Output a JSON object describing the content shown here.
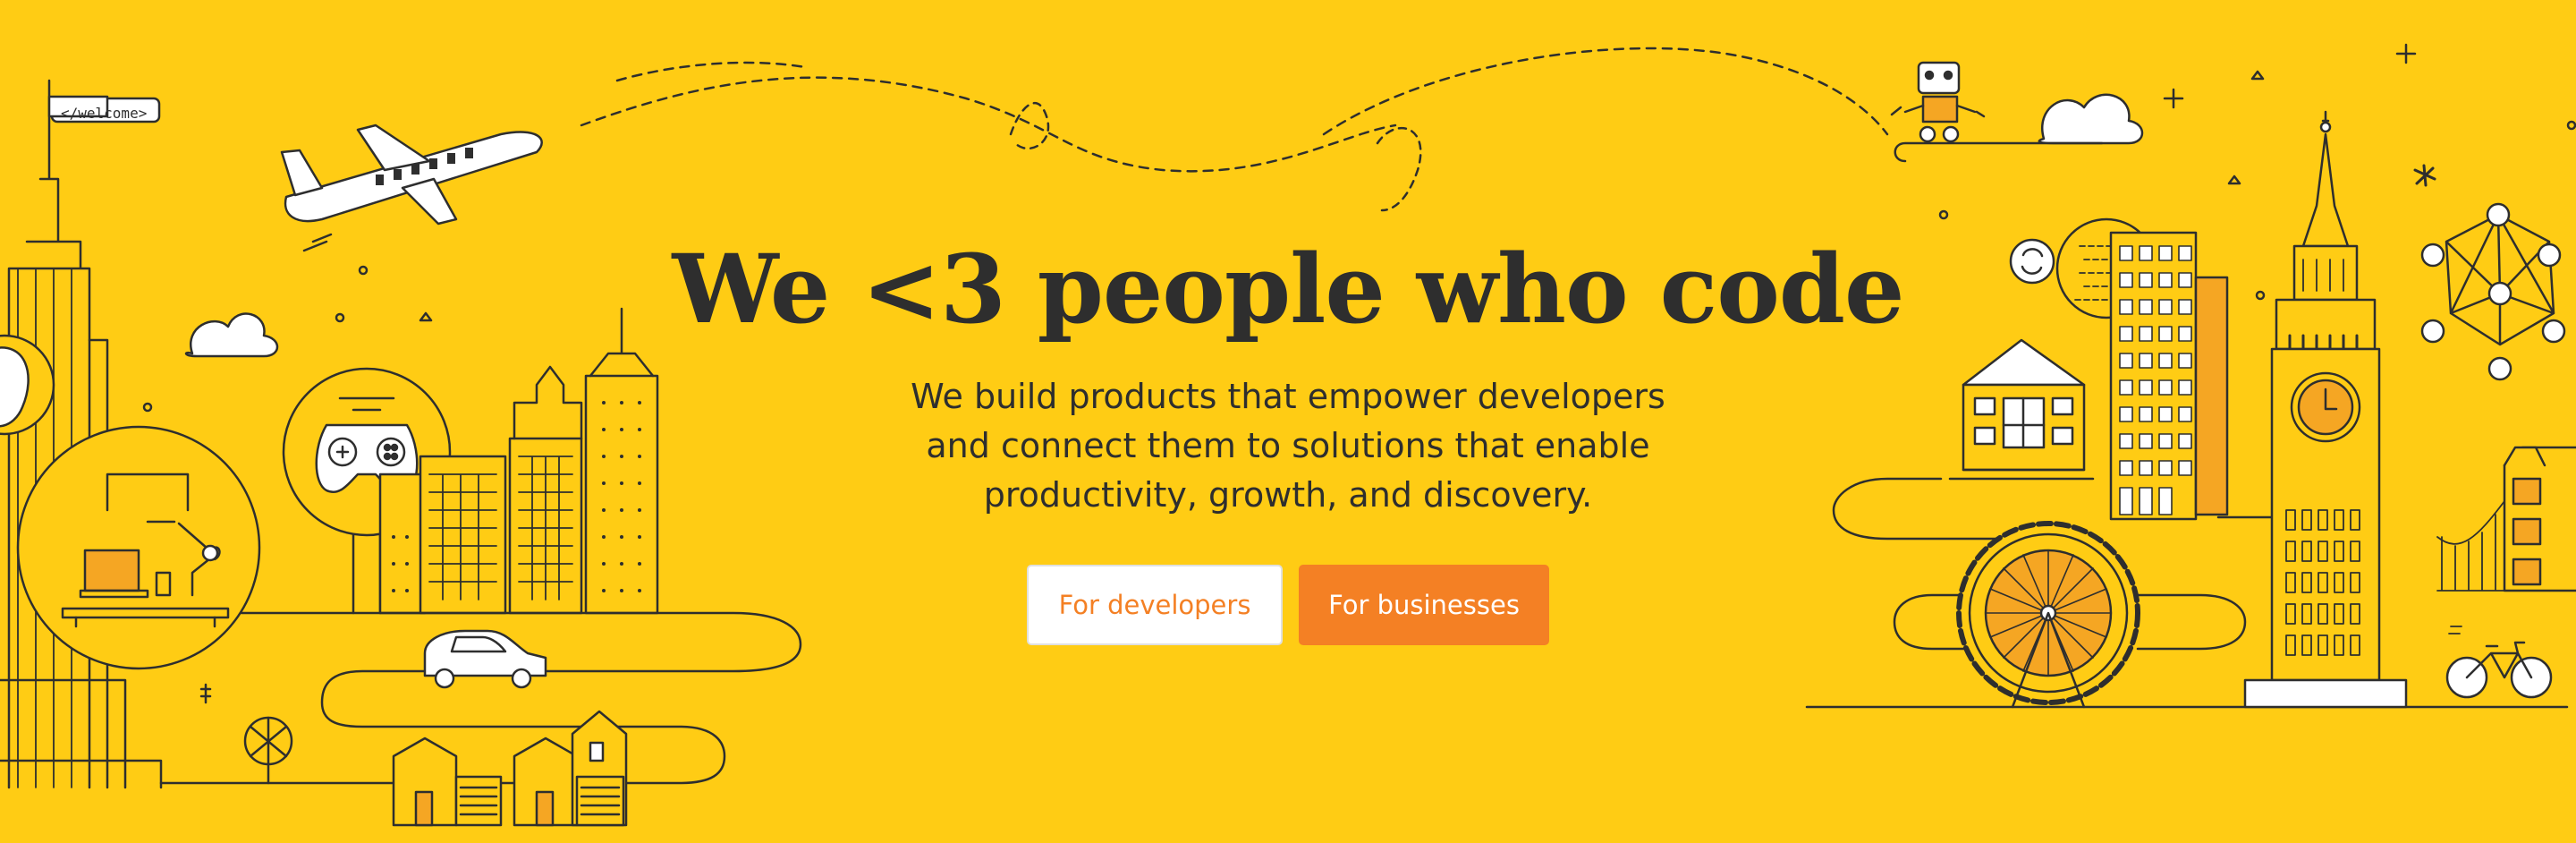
{
  "hero": {
    "title": "We <3 people who code",
    "subtitle_lines": [
      "We build products that empower developers",
      "and connect them to solutions that enable",
      "productivity, growth, and discovery."
    ]
  },
  "buttons": {
    "developers": "For developers",
    "businesses": "For businesses"
  },
  "illustration": {
    "flag_text": "</welcome>",
    "icons": [
      "airplane-icon",
      "cloud-icon",
      "gamepad-icon",
      "car-icon",
      "house-icon",
      "laptop-icon",
      "robot-icon",
      "sync-icon",
      "clock-tower-icon",
      "ferris-wheel-icon",
      "bicycle-icon",
      "network-icon",
      "building-icon"
    ]
  },
  "colors": {
    "background": "#ffcc14",
    "text": "#2e2e2e",
    "accent": "#f48024",
    "line": "#2e2e2e"
  }
}
